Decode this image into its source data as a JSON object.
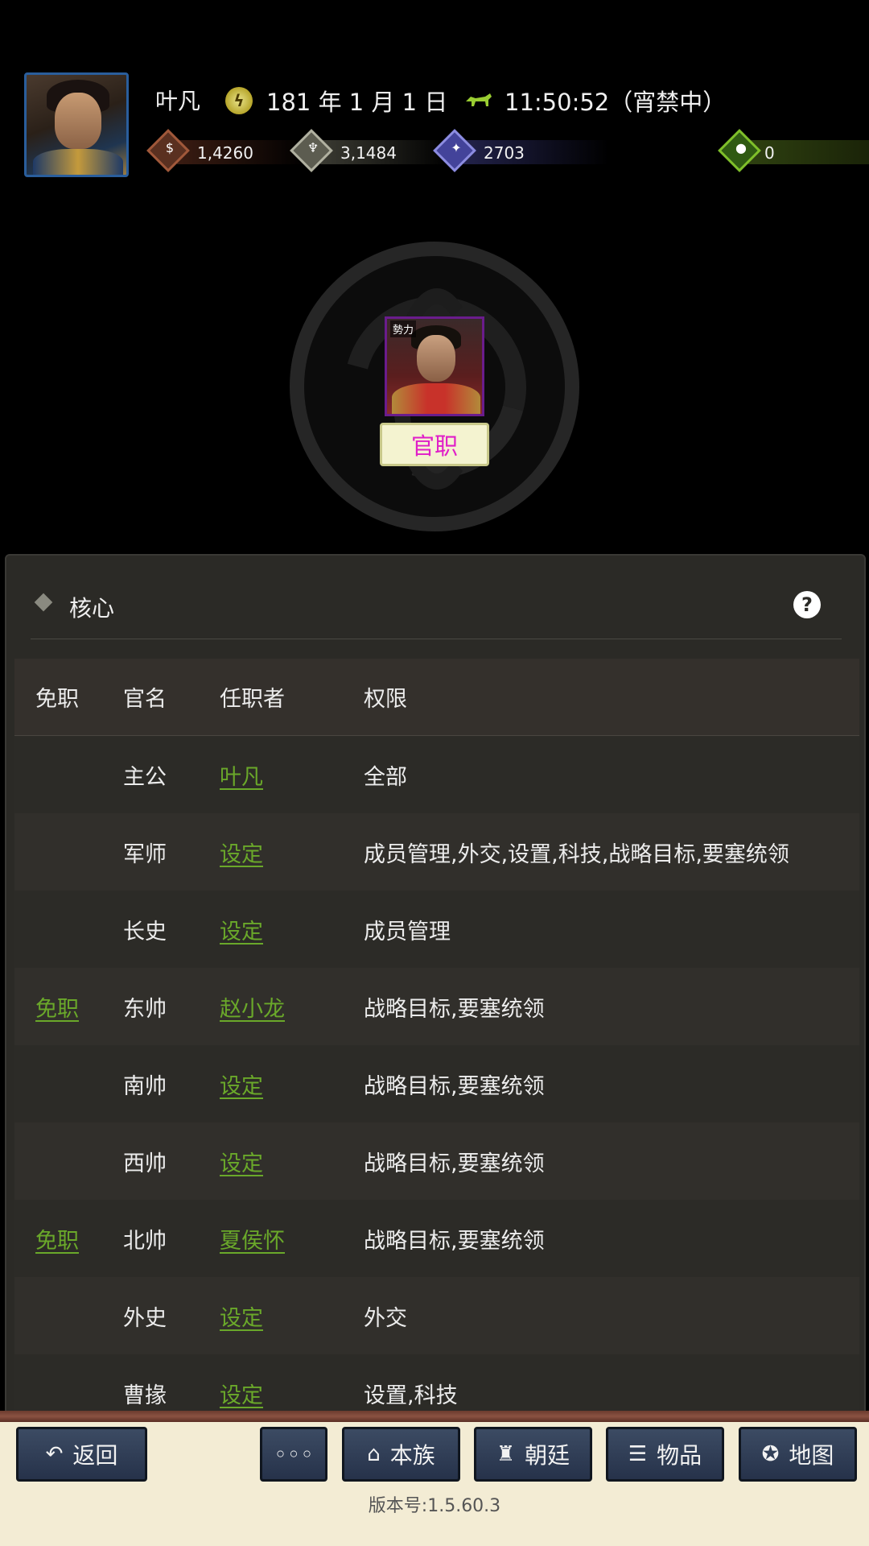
{
  "header": {
    "player_name": "叶凡",
    "date": "181 年 1 月 1 日",
    "time": "11:50:52（宵禁中）",
    "resources": {
      "money": "1,4260",
      "food": "3,1484",
      "power": "2703",
      "bag": "0"
    }
  },
  "leader": {
    "badge": "勢力",
    "office_button": "官职"
  },
  "panel": {
    "title": "核心",
    "help_symbol": "?",
    "columns": [
      "免职",
      "官名",
      "任职者",
      "权限"
    ],
    "rows": [
      {
        "dismiss": "",
        "office": "主公",
        "holder": "叶凡",
        "perms": "全部"
      },
      {
        "dismiss": "",
        "office": "军师",
        "holder": "设定",
        "perms": "成员管理,外交,设置,科技,战略目标,要塞统领"
      },
      {
        "dismiss": "",
        "office": "长史",
        "holder": "设定",
        "perms": "成员管理"
      },
      {
        "dismiss": "免职",
        "office": "东帅",
        "holder": "赵小龙",
        "perms": "战略目标,要塞统领"
      },
      {
        "dismiss": "",
        "office": "南帅",
        "holder": "设定",
        "perms": "战略目标,要塞统领"
      },
      {
        "dismiss": "",
        "office": "西帅",
        "holder": "设定",
        "perms": "战略目标,要塞统领"
      },
      {
        "dismiss": "免职",
        "office": "北帅",
        "holder": "夏侯怀",
        "perms": "战略目标,要塞统领"
      },
      {
        "dismiss": "",
        "office": "外史",
        "holder": "设定",
        "perms": "外交"
      },
      {
        "dismiss": "",
        "office": "曹掾",
        "holder": "设定",
        "perms": "设置,科技"
      }
    ]
  },
  "bottom_bar": {
    "back": "返回",
    "more": "◦◦◦",
    "clan": "本族",
    "court": "朝廷",
    "items": "物品",
    "map": "地图",
    "version": "版本号:1.5.60.3"
  },
  "colors": {
    "link_green": "#6aa82a",
    "office_text_magenta": "#e01ec8",
    "button_navy": "#2e3b55"
  }
}
